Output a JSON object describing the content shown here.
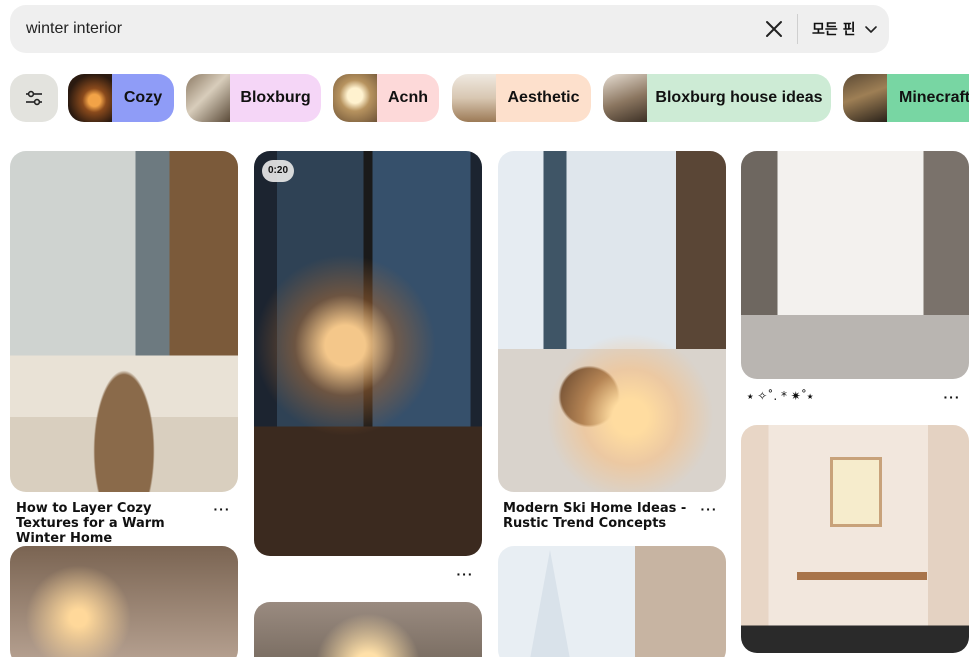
{
  "search": {
    "query": "winter interior",
    "scope_label": "모든 핀"
  },
  "chips": [
    {
      "label": "Cozy",
      "color": "#8f9cf7"
    },
    {
      "label": "Bloxburg",
      "color": "#f5d6f7"
    },
    {
      "label": "Acnh",
      "color": "#fdd9d9"
    },
    {
      "label": "Aesthetic",
      "color": "#fde0cc"
    },
    {
      "label": "Bloxburg house ideas",
      "color": "#cdebd5"
    },
    {
      "label": "Minecraft",
      "color": "#78d6a3"
    }
  ],
  "pins": {
    "p1": {
      "caption": "How to Layer Cozy Textures for a Warm Winter Home",
      "more": "···"
    },
    "p2": {
      "badge": "0:20",
      "more": "···"
    },
    "p3": {
      "caption": "Modern Ski Home Ideas - Rustic Trend Concepts",
      "more": "···"
    },
    "p4": {
      "caption": "⭑ ✧˚. * ✷˚⭑",
      "more": "···"
    }
  },
  "icons": {
    "clear": "close-icon",
    "scope": "chevron-down-icon",
    "filter": "sliders-icon"
  }
}
